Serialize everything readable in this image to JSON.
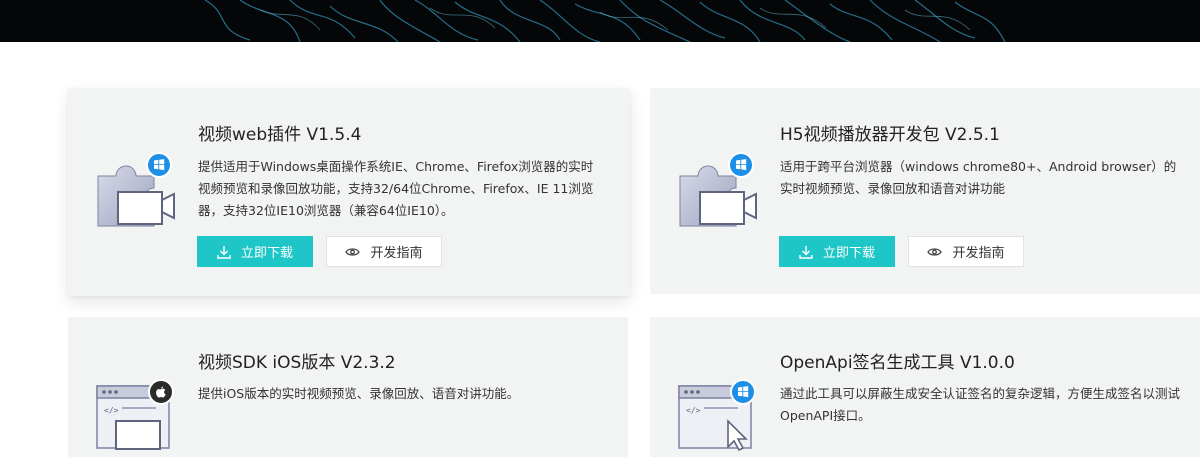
{
  "colors": {
    "accent": "#1fc6c7",
    "card_bg": "#f2f3f3",
    "banner_bg": "#050607",
    "windows_badge": "#1e8fe6",
    "apple_badge": "#2b2b2b"
  },
  "cards": [
    {
      "title": "视频web插件 V1.5.4",
      "description": "提供适用于Windows桌面操作系统IE、Chrome、Firefox浏览器的实时视频预览和录像回放功能，支持32/64位Chrome、Firefox、IE 11浏览器，支持32位IE10浏览器（兼容64位IE10）。",
      "download_label": "立即下载",
      "guide_label": "开发指南",
      "badge_icon": "windows-icon",
      "illustration": "plugin-camera-illustration"
    },
    {
      "title": "H5视频播放器开发包 V2.5.1",
      "description": "适用于跨平台浏览器（windows chrome80+、Android browser）的实时视频预览、录像回放和语音对讲功能",
      "download_label": "立即下载",
      "guide_label": "开发指南",
      "badge_icon": "windows-icon",
      "illustration": "plugin-camera-illustration"
    },
    {
      "title": "视频SDK iOS版本 V2.3.2",
      "description": "提供iOS版本的实时视频预览、录像回放、语音对讲功能。",
      "badge_icon": "apple-icon",
      "illustration": "code-window-illustration"
    },
    {
      "title": "OpenApi签名生成工具 V1.0.0",
      "description": "通过此工具可以屏蔽生成安全认证签名的复杂逻辑，方便生成签名以测试OpenAPI接口。",
      "badge_icon": "windows-icon",
      "illustration": "code-window-illustration"
    }
  ]
}
